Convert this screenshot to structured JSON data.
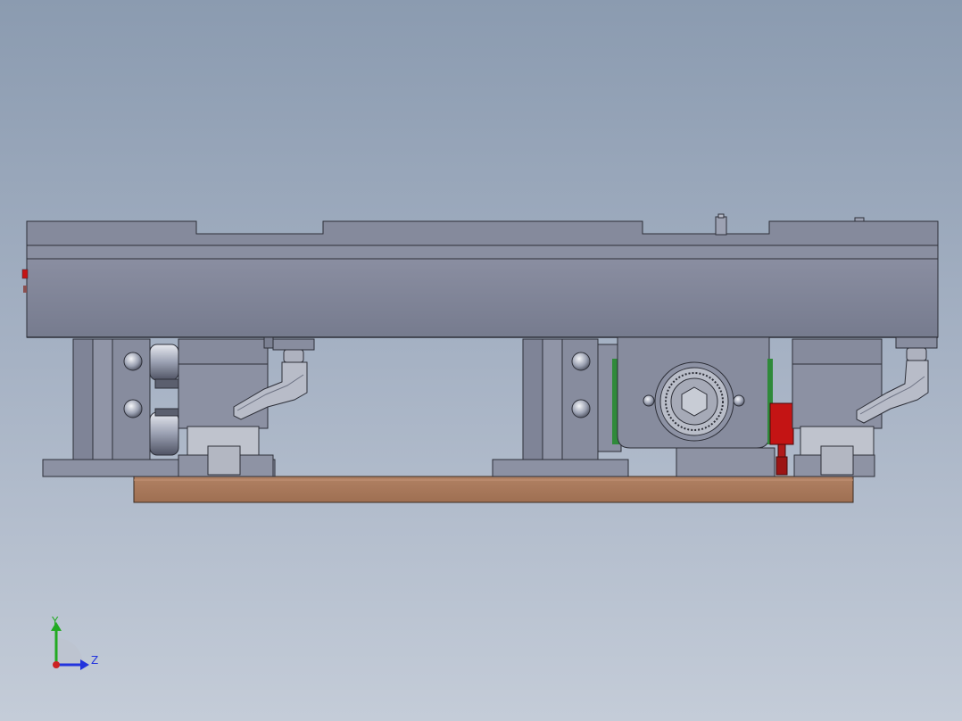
{
  "window": {
    "title": ""
  },
  "triad": {
    "y_label": "Y",
    "z_label": "Z",
    "y_color": "#22aa22",
    "z_color": "#2233dd",
    "x_color": "#cc2222"
  },
  "colors": {
    "steel": "#7e8396",
    "steel_light": "#9a9fb1",
    "steel_dark": "#5d6172",
    "wood": "#a8785a",
    "red_accent": "#c41414",
    "green_accent": "#2f8a3a"
  },
  "icons": {
    "coordinate_triad": "axis-triad-icon"
  }
}
